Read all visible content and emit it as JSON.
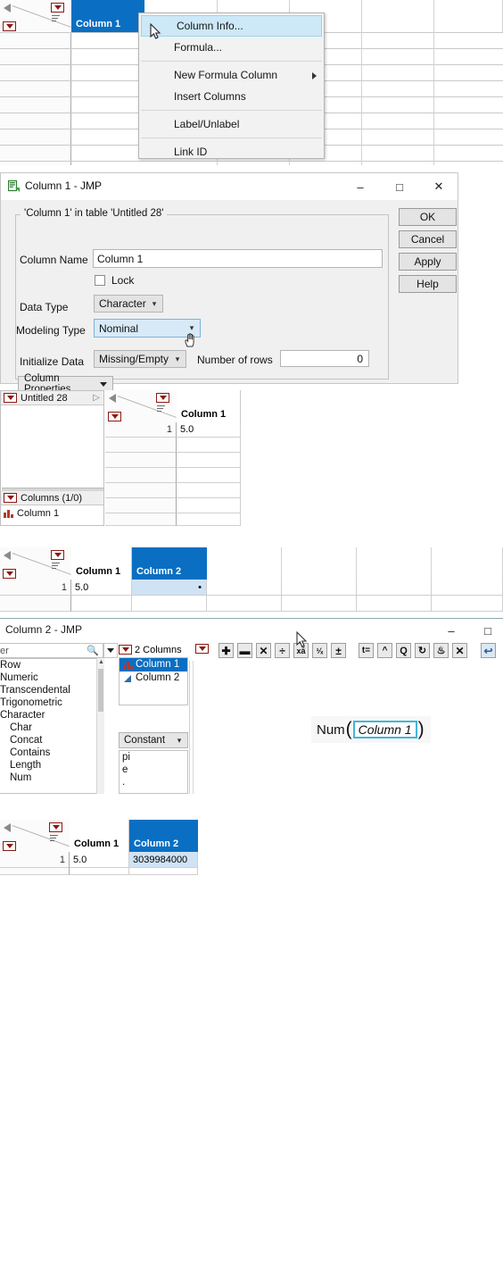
{
  "context_menu": {
    "name": "column-context-menu",
    "items": [
      {
        "label": "Column Info...",
        "highlighted": true,
        "submenu": false,
        "sep_after": false
      },
      {
        "label": "Formula...",
        "highlighted": false,
        "submenu": false,
        "sep_after": true
      },
      {
        "label": "New Formula Column",
        "highlighted": false,
        "submenu": true,
        "sep_after": false
      },
      {
        "label": "Insert Columns",
        "highlighted": false,
        "submenu": false,
        "sep_after": true
      },
      {
        "label": "Label/Unlabel",
        "highlighted": false,
        "submenu": false,
        "sep_after": true
      },
      {
        "label": "Link ID",
        "highlighted": false,
        "submenu": false,
        "sep_after": false
      }
    ]
  },
  "top_table": {
    "selected_column_header": "Column 1"
  },
  "column_info_dialog": {
    "title": "Column 1 - JMP",
    "minimize_label": "–",
    "maximize_label": "□",
    "close_label": "✕",
    "group_label": "'Column 1' in table 'Untitled 28'",
    "column_name_label": "Column Name",
    "column_name_value": "Column 1",
    "lock_label": "Lock",
    "lock_checked": false,
    "data_type_label": "Data Type",
    "data_type_value": "Character",
    "modeling_type_label": "Modeling Type",
    "modeling_type_value": "Nominal",
    "initialize_data_label": "Initialize Data",
    "initialize_data_value": "Missing/Empty",
    "number_of_rows_label": "Number of rows",
    "number_of_rows_value": "0",
    "column_properties_label": "Column Properties",
    "buttons": {
      "ok": "OK",
      "cancel": "Cancel",
      "apply": "Apply",
      "help": "Help"
    }
  },
  "data_table_mid": {
    "table_name": "Untitled 28",
    "columns_section_label": "Columns (1/0)",
    "column_list": [
      "Column 1"
    ],
    "grid": {
      "headers": [
        "Column 1"
      ],
      "rows": [
        {
          "num": "1",
          "cells": [
            "5.0"
          ]
        }
      ],
      "empty_rows": 6
    }
  },
  "data_table_two_cols": {
    "headers": [
      "Column 1",
      "Column 2"
    ],
    "selected_header": "Column 2",
    "rows": [
      {
        "num": "1",
        "cells": [
          "5.0",
          "•"
        ]
      }
    ],
    "empty_rows": 1
  },
  "formula_window": {
    "title": "Column 2 - JMP",
    "minimize_label": "–",
    "maximize_label": "□",
    "search_value": "er",
    "search_icon": "search-icon",
    "function_groups": [
      {
        "label": "Row",
        "indent": false
      },
      {
        "label": "Numeric",
        "indent": false
      },
      {
        "label": "Transcendental",
        "indent": false
      },
      {
        "label": "Trigonometric",
        "indent": false
      },
      {
        "label": "Character",
        "indent": false
      },
      {
        "label": "Char",
        "indent": true
      },
      {
        "label": "Concat",
        "indent": true
      },
      {
        "label": "Contains",
        "indent": true
      },
      {
        "label": "Length",
        "indent": true
      },
      {
        "label": "Num",
        "indent": true
      }
    ],
    "columns_panel_label": "2 Columns",
    "columns_panel_items": [
      {
        "label": "Column 1",
        "selected": true,
        "icon": "nominal-bars-icon"
      },
      {
        "label": "Column 2",
        "selected": false,
        "icon": "continuous-triangle-icon"
      }
    ],
    "constant_select_value": "Constant",
    "constant_items": [
      "pi",
      "e",
      "."
    ],
    "toolbar_buttons": [
      {
        "name": "add-button",
        "glyph": "✚"
      },
      {
        "name": "subtract-button",
        "glyph": "➖"
      },
      {
        "name": "multiply-button",
        "glyph": "✕"
      },
      {
        "name": "divide-button",
        "glyph": "÷"
      },
      {
        "name": "exponent-button",
        "glyph": "xʸ"
      },
      {
        "name": "reciprocal-button",
        "glyph": "¹⁄ₓ"
      },
      {
        "name": "plus-minus-button",
        "glyph": "±"
      },
      {
        "name": "local-variable-button",
        "glyph": "t="
      },
      {
        "name": "insert-above-button",
        "glyph": "ⱏ"
      },
      {
        "name": "peel-button",
        "glyph": "Q"
      },
      {
        "name": "swap-button",
        "glyph": "↻"
      },
      {
        "name": "unpeel-button",
        "glyph": "♁"
      },
      {
        "name": "delete-button",
        "glyph": "✕"
      },
      {
        "name": "undo-button",
        "glyph": "↩"
      }
    ],
    "formula": {
      "function_name": "Num",
      "open_paren": "(",
      "argument": "Column 1",
      "close_paren": ")"
    }
  },
  "result_table": {
    "headers": [
      "Column 1",
      "Column 2"
    ],
    "selected_header": "Column 2",
    "rows": [
      {
        "num": "1",
        "cells": [
          "5.0",
          "3039984000"
        ]
      }
    ]
  },
  "colors": {
    "selection_blue": "#0a6fc2",
    "cell_select_blue": "#cfe3f5",
    "menu_highlight": "#cde8f7",
    "red_triangle": "#8b1a14",
    "formula_box_outline": "#3fb6d8"
  }
}
